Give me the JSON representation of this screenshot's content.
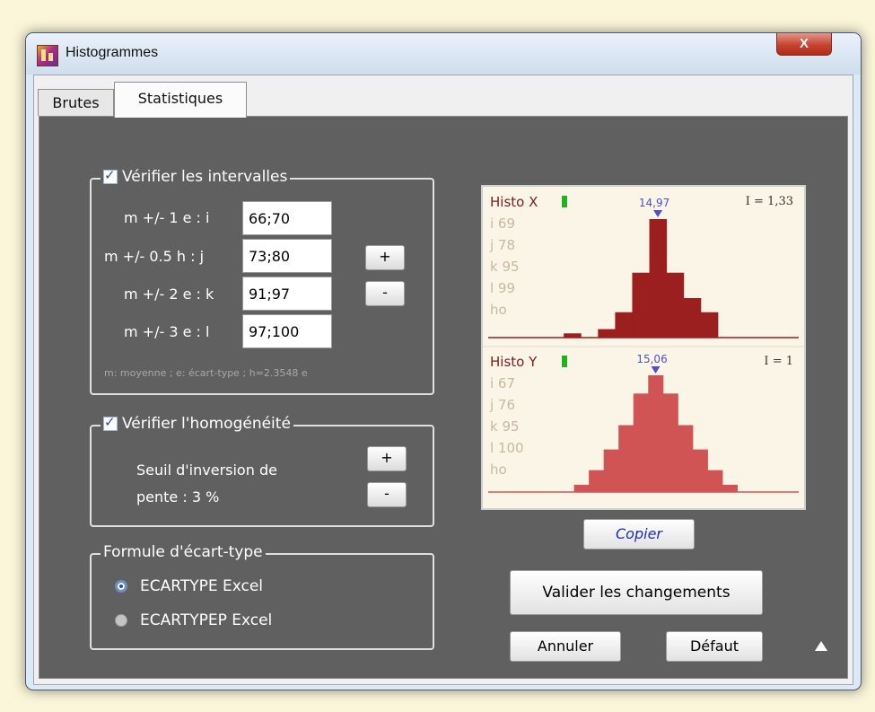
{
  "window": {
    "title": "Histogrammes",
    "close_label": "X"
  },
  "tabs": [
    {
      "label": "Brutes",
      "active": false
    },
    {
      "label": "Statistiques",
      "active": true
    }
  ],
  "intervals": {
    "legend": "Vérifier les intervalles",
    "checked": true,
    "rows": [
      {
        "label": "m +/- 1 e :  i",
        "value": "66;70"
      },
      {
        "label": "m +/- 0.5 h :  j",
        "value": "73;80"
      },
      {
        "label": "m +/- 2 e :  k",
        "value": "91;97"
      },
      {
        "label": "m +/- 3 e :  l",
        "value": "97;100"
      }
    ],
    "plus_label": "+",
    "minus_label": "-",
    "note": "m: moyenne ; e: écart-type ; h=2.3548 e"
  },
  "homogeneity": {
    "legend": "Vérifier l'homogénéité",
    "checked": true,
    "line1": "Seuil d'inversion de",
    "line2": "pente : 3 %",
    "plus_label": "+",
    "minus_label": "-"
  },
  "formula": {
    "legend": "Formule d'écart-type",
    "options": [
      {
        "label": "ECARTYPE Excel",
        "selected": true
      },
      {
        "label": "ECARTYPEP Excel",
        "selected": false
      }
    ]
  },
  "chart_data": [
    {
      "type": "bar",
      "title": "Histo X",
      "peak_label": "14,97",
      "info": "I = 1,33",
      "stats": [
        "i 69",
        "j 78",
        "k 95",
        "l 99",
        "ho"
      ],
      "values": [
        0,
        0,
        3,
        0,
        6,
        18,
        46,
        84,
        46,
        28,
        18,
        0,
        0
      ],
      "color": "#9b1f1f",
      "indicator_color": "#22b022"
    },
    {
      "type": "bar",
      "title": "Histo Y",
      "peak_label": "15,06",
      "info": "I = 1",
      "stats": [
        "i 67",
        "j 76",
        "k 95",
        "l 100",
        "ho"
      ],
      "values": [
        0,
        0,
        0,
        6,
        18,
        35,
        55,
        81,
        96,
        81,
        55,
        35,
        18,
        6,
        0
      ],
      "color": "#d05454",
      "indicator_color": "#22b022"
    }
  ],
  "buttons": {
    "copy": "Copier",
    "validate": "Valider les changements",
    "cancel": "Annuler",
    "default": "Défaut"
  },
  "colors": {
    "panel_bg": "#606060",
    "chart_bg": "#fbf5e8",
    "stats_text": "#c9b8a0",
    "peak_marker": "#5050c8"
  }
}
